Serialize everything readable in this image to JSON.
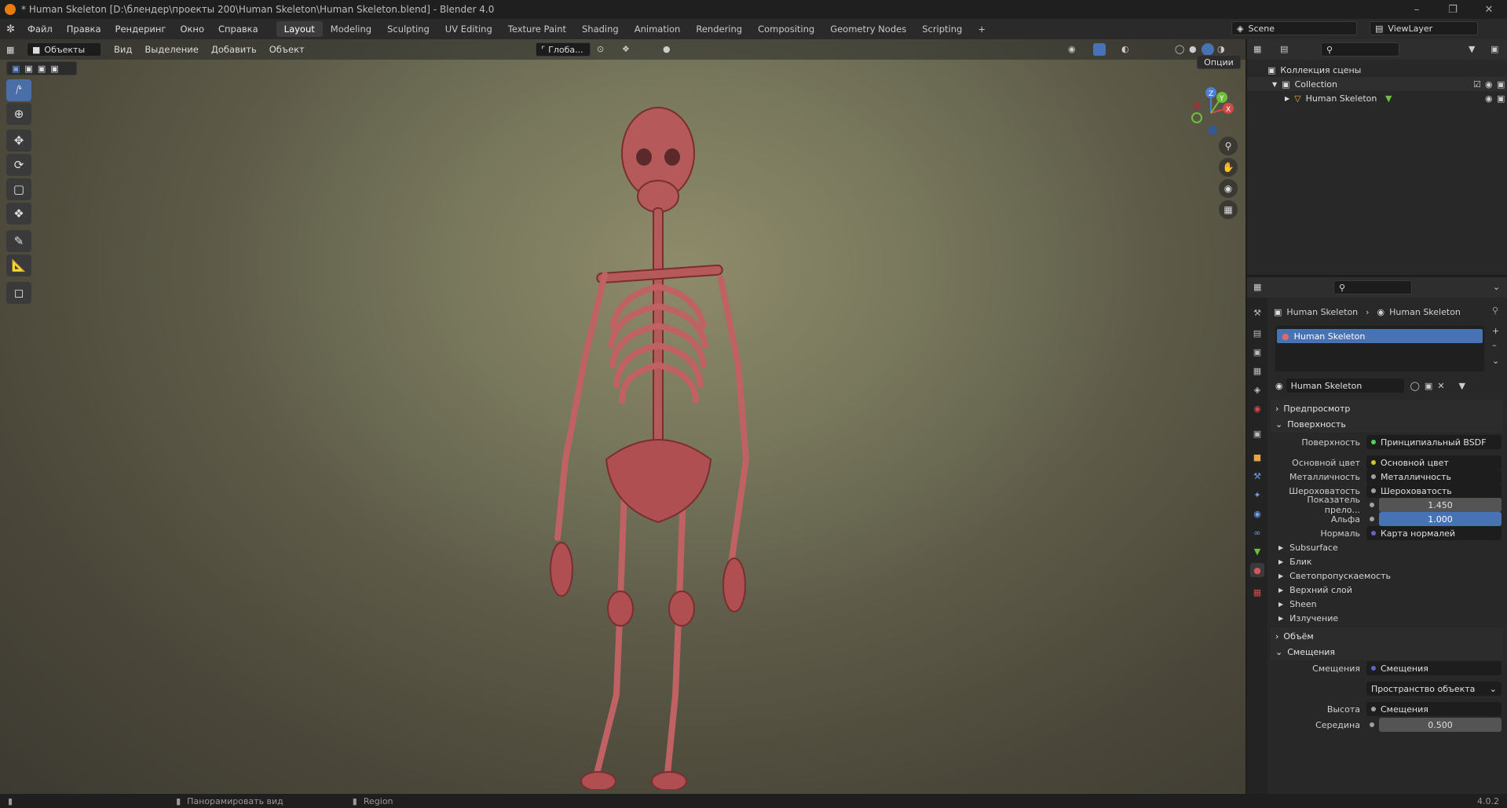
{
  "window": {
    "title": "* Human Skeleton [D:\\блендер\\проекты 200\\Human Skeleton\\Human Skeleton.blend] - Blender 4.0"
  },
  "menu": [
    "Файл",
    "Правка",
    "Рендеринг",
    "Окно",
    "Справка"
  ],
  "workspaces": [
    "Layout",
    "Modeling",
    "Sculpting",
    "UV Editing",
    "Texture Paint",
    "Shading",
    "Animation",
    "Rendering",
    "Compositing",
    "Geometry Nodes",
    "Scripting"
  ],
  "active_workspace": "Layout",
  "scene": {
    "name": "Scene",
    "view_layer": "ViewLayer"
  },
  "viewport": {
    "mode": "Объекты",
    "header_menu": [
      "Вид",
      "Выделение",
      "Добавить",
      "Объект"
    ],
    "orientation": "Глоба...",
    "options_label": "Опции"
  },
  "outliner": {
    "root": "Коллекция сцены",
    "collection": "Collection",
    "object": "Human Skeleton"
  },
  "properties": {
    "breadcrumb_object": "Human Skeleton",
    "breadcrumb_material": "Human Skeleton",
    "slot": "Human Skeleton",
    "material_name": "Human Skeleton",
    "sections": {
      "preview": "Предпросмотр",
      "surface": "Поверхность",
      "volume": "Объём",
      "displacement": "Смещения"
    },
    "surface_rows": [
      {
        "label": "Поверхность",
        "value": "Принципиальный BSDF",
        "dot": "#4fd15a"
      },
      {
        "label": "Основной цвет",
        "value": "Основной цвет",
        "dot": "#c7c729"
      },
      {
        "label": "Металличность",
        "value": "Металличность",
        "dot": "#a1a1a1"
      },
      {
        "label": "Шероховатость",
        "value": "Шероховатость",
        "dot": "#a1a1a1"
      },
      {
        "label": "Показатель прело...",
        "value": "1.450",
        "dot": "#a1a1a1"
      },
      {
        "label": "Альфа",
        "value": "1.000",
        "dot": "#a1a1a1"
      },
      {
        "label": "Нормаль",
        "value": "Карта нормалей",
        "dot": "#6363c7"
      }
    ],
    "subpanels": [
      "Subsurface",
      "Блик",
      "Светопропускаемость",
      "Верхний слой",
      "Sheen",
      "Излучение"
    ],
    "disp_rows": [
      {
        "label": "Смещения",
        "value": "Смещения"
      },
      {
        "label": "",
        "value": "Пространство объекта"
      },
      {
        "label": "Высота",
        "value": "Смещения"
      },
      {
        "label": "Середина",
        "value": "0.500"
      }
    ]
  },
  "status": {
    "pan": "Панорамировать вид",
    "region": "Region",
    "version": "4.0.2"
  },
  "colors": {
    "accent": "#4772b3",
    "brand": "#e87d0d"
  }
}
